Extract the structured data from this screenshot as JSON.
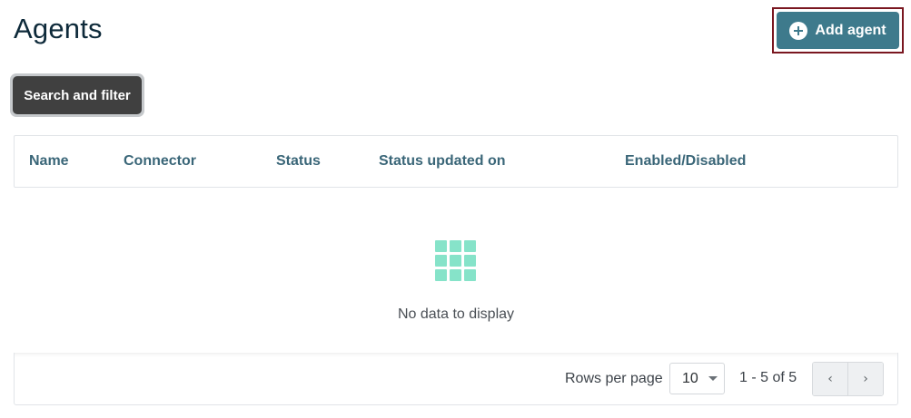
{
  "page": {
    "title": "Agents"
  },
  "toolbar": {
    "add_label": "Add agent",
    "search_filter_label": "Search and filter"
  },
  "table": {
    "columns": [
      "Name",
      "Connector",
      "Status",
      "Status updated on",
      "Enabled/Disabled"
    ],
    "empty_message": "No data to display"
  },
  "pagination": {
    "rows_per_page_label": "Rows per page",
    "rows_per_page_value": "10",
    "range_text": "1 - 5 of 5",
    "prev_symbol": "‹",
    "next_symbol": "›"
  },
  "colors": {
    "accent": "#3e7a8c",
    "focus_ring": "#7a1720",
    "header_text": "#3a6678",
    "empty_icon": "#86e3c9"
  },
  "icons": {
    "add": "plus-circle-icon",
    "empty": "grid-icon",
    "select": "caret-down-icon",
    "prev": "chevron-left-icon",
    "next": "chevron-right-icon"
  }
}
